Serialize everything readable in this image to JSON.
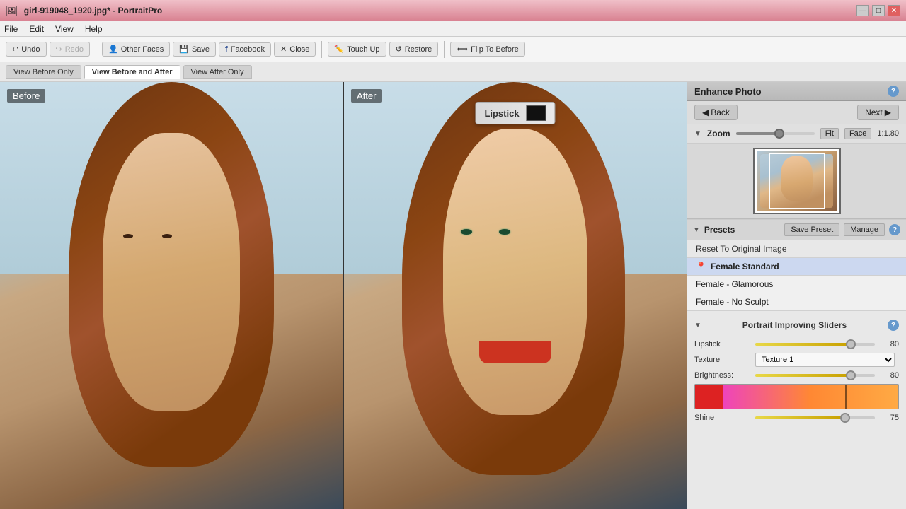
{
  "titleBar": {
    "title": "girl-919048_1920.jpg* - PortraitPro",
    "minBtn": "—",
    "maxBtn": "□",
    "closeBtn": "✕"
  },
  "menuBar": {
    "items": [
      "File",
      "Edit",
      "View",
      "Help"
    ]
  },
  "toolbar": {
    "undoLabel": "Undo",
    "redoLabel": "Redo",
    "otherFacesLabel": "Other Faces",
    "saveLabel": "Save",
    "facebookLabel": "Facebook",
    "closeLabel": "Close",
    "touchUpLabel": "Touch Up",
    "restoreLabel": "Restore",
    "flipToBeforeLabel": "Flip To Before"
  },
  "viewTabs": {
    "tab1": "View Before Only",
    "tab2": "View Before and After",
    "tab3": "View After Only"
  },
  "panels": {
    "beforeLabel": "Before",
    "afterLabel": "After"
  },
  "lipstickPopup": {
    "label": "Lipstick"
  },
  "rightPanel": {
    "enhanceTitle": "Enhance Photo",
    "backLabel": "Back",
    "nextLabel": "Next",
    "zoomLabel": "Zoom",
    "fitLabel": "Fit",
    "faceLabel": "Face",
    "zoomValue": "1:1.80",
    "presetsTitle": "Presets",
    "savePresetLabel": "Save Preset",
    "manageLabel": "Manage",
    "resetLabel": "Reset To Original Image",
    "femaleStandard": "Female Standard",
    "femaleGlamorous": "Female - Glamorous",
    "femaleNoSculpt": "Female - No Sculpt",
    "slidersTitle": "Portrait Improving Sliders",
    "lipstickSliderLabel": "Lipstick",
    "lipstickValue": "80",
    "textureLabel": "Texture",
    "textureOption": "Texture 1",
    "brightnessLabel": "Brightness:",
    "brightnessValue": "80",
    "shineLabel": "Shine",
    "shineValue": "75"
  }
}
